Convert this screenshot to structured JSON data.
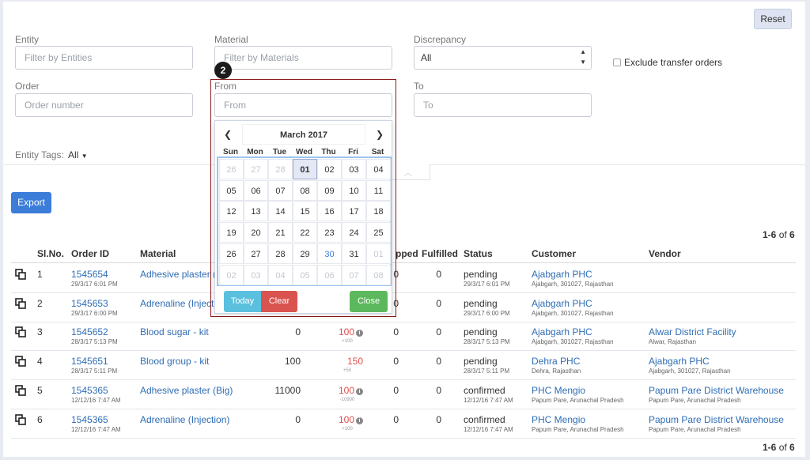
{
  "filters": {
    "reset_label": "Reset",
    "entity_label": "Entity",
    "entity_placeholder": "Filter by Entities",
    "material_label": "Material",
    "material_placeholder": "Filter by Materials",
    "discrepancy_label": "Discrepancy",
    "discrepancy_value": "All",
    "exclude_label": "Exclude transfer orders",
    "order_label": "Order",
    "order_placeholder": "Order number",
    "from_label": "From",
    "from_placeholder": "From",
    "to_label": "To",
    "to_placeholder": "To",
    "entity_tags_label": "Entity Tags:",
    "entity_tags_value": "All"
  },
  "toolbar": {
    "export_label": "Export",
    "count_top": "1-6",
    "count_of": "of",
    "count_total": "6"
  },
  "table": {
    "headers": {
      "slno": "Sl.No.",
      "order_id": "Order ID",
      "material": "Material",
      "shipped_partial": "pped",
      "fulfilled": "Fulfilled",
      "status": "Status",
      "customer": "Customer",
      "vendor": "Vendor"
    },
    "rows": [
      {
        "sl": "1",
        "order_id": "1545654",
        "date": "29/3/17 6:01 PM",
        "material": "Adhesive plaster (S",
        "ordered": "",
        "allocated": "",
        "allocated_sub": "",
        "shipped": "0",
        "fulfilled": "0",
        "status": "pending",
        "status_date": "29/3/17 6:01 PM",
        "customer": "Ajabgarh PHC",
        "customer_addr": "Ajabgarh, 301027, Rajasthan",
        "vendor": "",
        "vendor_addr": ""
      },
      {
        "sl": "2",
        "order_id": "1545653",
        "date": "29/3/17 6:00 PM",
        "material": "Adrenaline (Injectio",
        "ordered": "",
        "allocated": "",
        "allocated_sub": "",
        "shipped": "0",
        "fulfilled": "0",
        "status": "pending",
        "status_date": "29/3/17 6:00 PM",
        "customer": "Ajabgarh PHC",
        "customer_addr": "Ajabgarh, 301027, Rajasthan",
        "vendor": "",
        "vendor_addr": ""
      },
      {
        "sl": "3",
        "order_id": "1545652",
        "date": "28/3/17 5:13 PM",
        "material": "Blood sugar - kit",
        "ordered": "0",
        "allocated": "100",
        "allocated_sub": "+100",
        "shipped": "0",
        "fulfilled": "0",
        "status": "pending",
        "status_date": "28/3/17 5:13 PM",
        "customer": "Ajabgarh PHC",
        "customer_addr": "Ajabgarh, 301027, Rajasthan",
        "vendor": "Alwar District Facility",
        "vendor_addr": "Alwar, Rajasthan"
      },
      {
        "sl": "4",
        "order_id": "1545651",
        "date": "28/3/17 5:11 PM",
        "material": "Blood group - kit",
        "ordered": "100",
        "allocated": "150",
        "allocated_sub": "+50",
        "shipped": "0",
        "fulfilled": "0",
        "status": "pending",
        "status_date": "28/3/17 5:11 PM",
        "customer": "Dehra PHC",
        "customer_addr": "Dehra, Rajasthan",
        "vendor": "Ajabgarh PHC",
        "vendor_addr": "Ajabgarh, 301027, Rajasthan"
      },
      {
        "sl": "5",
        "order_id": "1545365",
        "date": "12/12/16 7:47 AM",
        "material": "Adhesive plaster (Big)",
        "ordered": "11000",
        "allocated": "100",
        "allocated_sub": "-10900",
        "shipped": "0",
        "fulfilled": "0",
        "status": "confirmed",
        "status_date": "12/12/16 7:47 AM",
        "customer": "PHC Mengio",
        "customer_addr": "Papum Pare, Arunachal Pradesh",
        "vendor": "Papum Pare District Warehouse",
        "vendor_addr": "Papum Pare, Arunachal Pradesh"
      },
      {
        "sl": "6",
        "order_id": "1545365",
        "date": "12/12/16 7:47 AM",
        "material": "Adrenaline (Injection)",
        "ordered": "0",
        "allocated": "100",
        "allocated_sub": "+100",
        "shipped": "0",
        "fulfilled": "0",
        "status": "confirmed",
        "status_date": "12/12/16 7:47 AM",
        "customer": "PHC Mengio",
        "customer_addr": "Papum Pare, Arunachal Pradesh",
        "vendor": "Papum Pare District Warehouse",
        "vendor_addr": "Papum Pare, Arunachal Pradesh"
      }
    ]
  },
  "annotation": {
    "step_number": "2"
  },
  "calendar": {
    "month_label": "March 2017",
    "prev": "❮",
    "next": "❯",
    "weekdays": [
      "Sun",
      "Mon",
      "Tue",
      "Wed",
      "Thu",
      "Fri",
      "Sat"
    ],
    "weeks": [
      [
        "26",
        "27",
        "28",
        "01",
        "02",
        "03",
        "04"
      ],
      [
        "05",
        "06",
        "07",
        "08",
        "09",
        "10",
        "11"
      ],
      [
        "12",
        "13",
        "14",
        "15",
        "16",
        "17",
        "18"
      ],
      [
        "19",
        "20",
        "21",
        "22",
        "23",
        "24",
        "25"
      ],
      [
        "26",
        "27",
        "28",
        "29",
        "30",
        "31",
        "01"
      ],
      [
        "02",
        "03",
        "04",
        "05",
        "06",
        "07",
        "08"
      ]
    ],
    "today_label": "Today",
    "clear_label": "Clear",
    "close_label": "Close"
  },
  "colors": {
    "accent": "#3b7dd8",
    "danger": "#d9534f",
    "success": "#5cb85c",
    "today": "#5bc0de",
    "highlight": "#8b1a1a"
  }
}
